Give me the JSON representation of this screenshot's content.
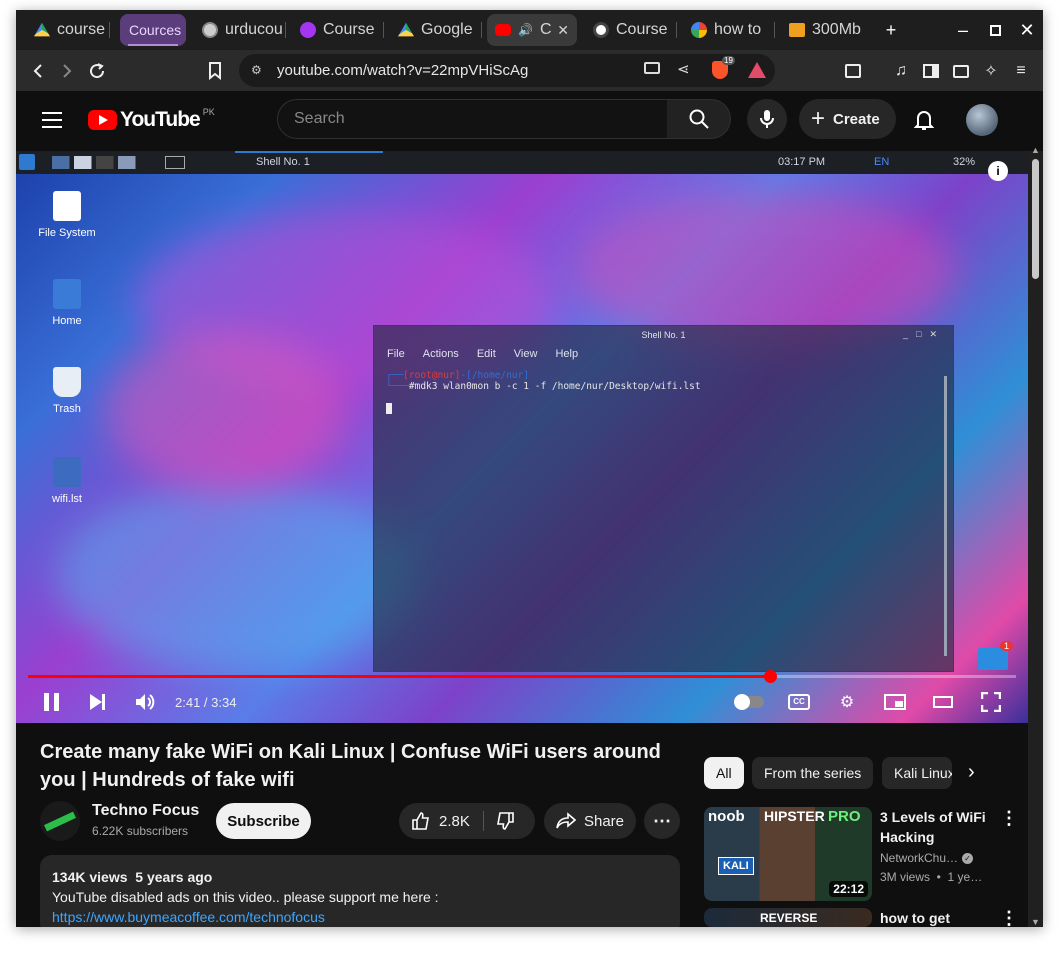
{
  "browser": {
    "tabs": [
      {
        "label": "course",
        "favicon": "google-drive-icon"
      },
      {
        "label": "Cources",
        "favicon": "tab-group"
      },
      {
        "label": "urducou",
        "favicon": "globe-icon"
      },
      {
        "label": "Course",
        "favicon": "udemy-icon"
      },
      {
        "label": "Google",
        "favicon": "google-drive-icon"
      },
      {
        "label": "C",
        "favicon": "youtube-icon"
      },
      {
        "label": "Course",
        "favicon": "chatgpt-icon"
      },
      {
        "label": "how to",
        "favicon": "google-icon"
      },
      {
        "label": "300Mb",
        "favicon": "gmail-icon"
      }
    ],
    "url": "youtube.com/watch?v=22mpVHiScAg",
    "brave_badge": "19"
  },
  "youtube": {
    "logo_text": "YouTube",
    "region": "PK",
    "search_placeholder": "Search",
    "create_label": "Create"
  },
  "video_desktop": {
    "taskbar_title": "Shell No. 1",
    "clock": "03:17 PM",
    "lang": "EN",
    "battery": "32%",
    "icons": [
      "File System",
      "Home",
      "Trash",
      "wifi.lst"
    ],
    "terminal": {
      "title": "Shell No. 1",
      "menu": [
        "File",
        "Actions",
        "Edit",
        "View",
        "Help"
      ],
      "prompt_user": "[root@nur]",
      "prompt_path": "-[/home/nur]",
      "command": "#mdk3 wlan0mon b -c 1 -f /home/nur/Desktop/wifi.lst"
    },
    "mail_badge": "1"
  },
  "player": {
    "time_current": "2:41",
    "time_total": "3:34",
    "time_display": "2:41 / 3:34",
    "progress_fraction": 0.751
  },
  "video": {
    "title": "Create many fake WiFi on Kali Linux | Confuse WiFi users around you | Hundreds of fake wifi",
    "channel": "Techno Focus",
    "subscribers": "6.22K subscribers",
    "subscribe_label": "Subscribe",
    "likes": "2.8K",
    "share_label": "Share",
    "views": "134K views",
    "age": "5 years ago",
    "description": "YouTube disabled ads on this video.. please support me here :",
    "link": "https://www.buymeacoffee.com/technofocus"
  },
  "sidebar": {
    "chips": [
      "All",
      "From the series",
      "Kali Linux"
    ],
    "recommendations": [
      {
        "title": "3 Levels of WiFi Hacking",
        "channel": "NetworkChu…",
        "meta": "3M views  •  1 ye…",
        "duration": "22:12",
        "thumb_words": [
          "noob",
          "HIPSTER",
          "PRO",
          "KALI"
        ]
      },
      {
        "title": "how to get",
        "thumb_words": [
          "REVERSE"
        ]
      }
    ]
  },
  "colors": {
    "accent_red": "#ff0000",
    "tab_group": "#5a3d7a",
    "bg": "#0f0f0f"
  }
}
